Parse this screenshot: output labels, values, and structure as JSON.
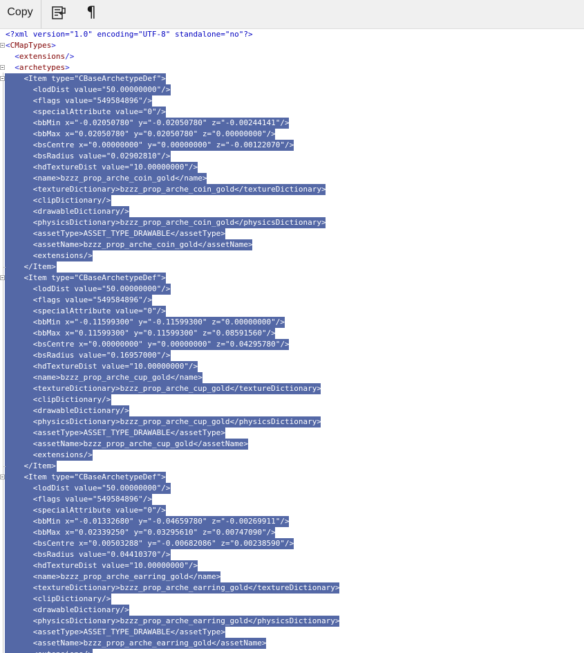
{
  "toolbar": {
    "copy_label": "Copy",
    "wrap_icon": "word-wrap-icon",
    "para_icon": "pilcrow-icon",
    "para_glyph": "¶"
  },
  "xml_lines": [
    {
      "indent": 0,
      "text": "<?xml version=\"1.0\" encoding=\"UTF-8\" standalone=\"no\"?>",
      "sel": false,
      "fold": false,
      "end": false
    },
    {
      "indent": 0,
      "text": "<CMapTypes>",
      "sel": false,
      "fold": true,
      "end": false
    },
    {
      "indent": 1,
      "text": "<extensions/>",
      "sel": false,
      "fold": false,
      "end": false
    },
    {
      "indent": 1,
      "text": "<archetypes>",
      "sel": false,
      "fold": true,
      "end": false
    },
    {
      "indent": 2,
      "text": "<Item type=\"CBaseArchetypeDef\">",
      "sel": true,
      "fold": true,
      "end": false
    },
    {
      "indent": 3,
      "text": "<lodDist value=\"50.00000000\"/>",
      "sel": true,
      "fold": false,
      "end": false
    },
    {
      "indent": 3,
      "text": "<flags value=\"549584896\"/>",
      "sel": true,
      "fold": false,
      "end": false
    },
    {
      "indent": 3,
      "text": "<specialAttribute value=\"0\"/>",
      "sel": true,
      "fold": false,
      "end": false
    },
    {
      "indent": 3,
      "text": "<bbMin x=\"-0.02050780\" y=\"-0.02050780\" z=\"-0.00244141\"/>",
      "sel": true,
      "fold": false,
      "end": false
    },
    {
      "indent": 3,
      "text": "<bbMax x=\"0.02050780\" y=\"0.02050780\" z=\"0.00000000\"/>",
      "sel": true,
      "fold": false,
      "end": false
    },
    {
      "indent": 3,
      "text": "<bsCentre x=\"0.00000000\" y=\"0.00000000\" z=\"-0.00122070\"/>",
      "sel": true,
      "fold": false,
      "end": false
    },
    {
      "indent": 3,
      "text": "<bsRadius value=\"0.02902810\"/>",
      "sel": true,
      "fold": false,
      "end": false
    },
    {
      "indent": 3,
      "text": "<hdTextureDist value=\"10.00000000\"/>",
      "sel": true,
      "fold": false,
      "end": false
    },
    {
      "indent": 3,
      "text": "<name>bzzz_prop_arche_coin_gold</name>",
      "sel": true,
      "fold": false,
      "end": false
    },
    {
      "indent": 3,
      "text": "<textureDictionary>bzzz_prop_arche_coin_gold</textureDictionary>",
      "sel": true,
      "fold": false,
      "end": false
    },
    {
      "indent": 3,
      "text": "<clipDictionary/>",
      "sel": true,
      "fold": false,
      "end": false
    },
    {
      "indent": 3,
      "text": "<drawableDictionary/>",
      "sel": true,
      "fold": false,
      "end": false
    },
    {
      "indent": 3,
      "text": "<physicsDictionary>bzzz_prop_arche_coin_gold</physicsDictionary>",
      "sel": true,
      "fold": false,
      "end": false
    },
    {
      "indent": 3,
      "text": "<assetType>ASSET_TYPE_DRAWABLE</assetType>",
      "sel": true,
      "fold": false,
      "end": false
    },
    {
      "indent": 3,
      "text": "<assetName>bzzz_prop_arche_coin_gold</assetName>",
      "sel": true,
      "fold": false,
      "end": false
    },
    {
      "indent": 3,
      "text": "<extensions/>",
      "sel": true,
      "fold": false,
      "end": false
    },
    {
      "indent": 2,
      "text": "</Item>",
      "sel": true,
      "fold": false,
      "end": true
    },
    {
      "indent": 2,
      "text": "<Item type=\"CBaseArchetypeDef\">",
      "sel": true,
      "fold": true,
      "end": false
    },
    {
      "indent": 3,
      "text": "<lodDist value=\"50.00000000\"/>",
      "sel": true,
      "fold": false,
      "end": false
    },
    {
      "indent": 3,
      "text": "<flags value=\"549584896\"/>",
      "sel": true,
      "fold": false,
      "end": false
    },
    {
      "indent": 3,
      "text": "<specialAttribute value=\"0\"/>",
      "sel": true,
      "fold": false,
      "end": false
    },
    {
      "indent": 3,
      "text": "<bbMin x=\"-0.11599300\" y=\"-0.11599300\" z=\"0.00000000\"/>",
      "sel": true,
      "fold": false,
      "end": false
    },
    {
      "indent": 3,
      "text": "<bbMax x=\"0.11599300\" y=\"0.11599300\" z=\"0.08591560\"/>",
      "sel": true,
      "fold": false,
      "end": false
    },
    {
      "indent": 3,
      "text": "<bsCentre x=\"0.00000000\" y=\"0.00000000\" z=\"0.04295780\"/>",
      "sel": true,
      "fold": false,
      "end": false
    },
    {
      "indent": 3,
      "text": "<bsRadius value=\"0.16957000\"/>",
      "sel": true,
      "fold": false,
      "end": false
    },
    {
      "indent": 3,
      "text": "<hdTextureDist value=\"10.00000000\"/>",
      "sel": true,
      "fold": false,
      "end": false
    },
    {
      "indent": 3,
      "text": "<name>bzzz_prop_arche_cup_gold</name>",
      "sel": true,
      "fold": false,
      "end": false
    },
    {
      "indent": 3,
      "text": "<textureDictionary>bzzz_prop_arche_cup_gold</textureDictionary>",
      "sel": true,
      "fold": false,
      "end": false
    },
    {
      "indent": 3,
      "text": "<clipDictionary/>",
      "sel": true,
      "fold": false,
      "end": false
    },
    {
      "indent": 3,
      "text": "<drawableDictionary/>",
      "sel": true,
      "fold": false,
      "end": false
    },
    {
      "indent": 3,
      "text": "<physicsDictionary>bzzz_prop_arche_cup_gold</physicsDictionary>",
      "sel": true,
      "fold": false,
      "end": false
    },
    {
      "indent": 3,
      "text": "<assetType>ASSET_TYPE_DRAWABLE</assetType>",
      "sel": true,
      "fold": false,
      "end": false
    },
    {
      "indent": 3,
      "text": "<assetName>bzzz_prop_arche_cup_gold</assetName>",
      "sel": true,
      "fold": false,
      "end": false
    },
    {
      "indent": 3,
      "text": "<extensions/>",
      "sel": true,
      "fold": false,
      "end": false
    },
    {
      "indent": 2,
      "text": "</Item>",
      "sel": true,
      "fold": false,
      "end": true
    },
    {
      "indent": 2,
      "text": "<Item type=\"CBaseArchetypeDef\">",
      "sel": true,
      "fold": true,
      "end": false
    },
    {
      "indent": 3,
      "text": "<lodDist value=\"50.00000000\"/>",
      "sel": true,
      "fold": false,
      "end": false
    },
    {
      "indent": 3,
      "text": "<flags value=\"549584896\"/>",
      "sel": true,
      "fold": false,
      "end": false
    },
    {
      "indent": 3,
      "text": "<specialAttribute value=\"0\"/>",
      "sel": true,
      "fold": false,
      "end": false
    },
    {
      "indent": 3,
      "text": "<bbMin x=\"-0.01332680\" y=\"-0.04659780\" z=\"-0.00269911\"/>",
      "sel": true,
      "fold": false,
      "end": false
    },
    {
      "indent": 3,
      "text": "<bbMax x=\"0.02339250\" y=\"0.03295610\" z=\"0.00747090\"/>",
      "sel": true,
      "fold": false,
      "end": false
    },
    {
      "indent": 3,
      "text": "<bsCentre x=\"0.00503288\" y=\"-0.00682086\" z=\"0.00238590\"/>",
      "sel": true,
      "fold": false,
      "end": false
    },
    {
      "indent": 3,
      "text": "<bsRadius value=\"0.04410370\"/>",
      "sel": true,
      "fold": false,
      "end": false
    },
    {
      "indent": 3,
      "text": "<hdTextureDist value=\"10.00000000\"/>",
      "sel": true,
      "fold": false,
      "end": false
    },
    {
      "indent": 3,
      "text": "<name>bzzz_prop_arche_earring_gold</name>",
      "sel": true,
      "fold": false,
      "end": false
    },
    {
      "indent": 3,
      "text": "<textureDictionary>bzzz_prop_arche_earring_gold</textureDictionary>",
      "sel": true,
      "fold": false,
      "end": false
    },
    {
      "indent": 3,
      "text": "<clipDictionary/>",
      "sel": true,
      "fold": false,
      "end": false
    },
    {
      "indent": 3,
      "text": "<drawableDictionary/>",
      "sel": true,
      "fold": false,
      "end": false
    },
    {
      "indent": 3,
      "text": "<physicsDictionary>bzzz_prop_arche_earring_gold</physicsDictionary>",
      "sel": true,
      "fold": false,
      "end": false
    },
    {
      "indent": 3,
      "text": "<assetType>ASSET_TYPE_DRAWABLE</assetType>",
      "sel": true,
      "fold": false,
      "end": false
    },
    {
      "indent": 3,
      "text": "<assetName>bzzz_prop_arche_earring_gold</assetName>",
      "sel": true,
      "fold": false,
      "end": false
    },
    {
      "indent": 3,
      "text": "<extensions/>",
      "sel": true,
      "fold": false,
      "end": false
    }
  ],
  "colors": {
    "selection": "#5468a6",
    "tag": "#800000",
    "attribute_name": "#c00000",
    "attribute_value": "#0000d0",
    "punctuation": "#2020d0"
  }
}
